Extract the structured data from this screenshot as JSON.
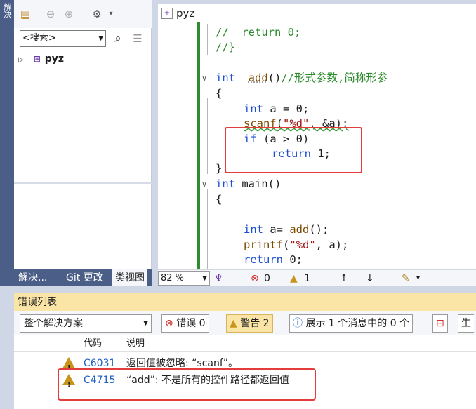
{
  "left_strip": {
    "label": "解决"
  },
  "solution_explorer": {
    "search_placeholder": "<搜索>",
    "project_name": "pyz",
    "tabs": [
      "解决...",
      "Git 更改",
      "类视图"
    ]
  },
  "editor": {
    "file_tab": "pyz",
    "lines": {
      "l0": "//  return 0;",
      "l1": "//}",
      "l2_kw": "int",
      "l2_fn": "add",
      "l2_rest": "()",
      "l2_cm": "//形式参数,简称形参",
      "l3": "{",
      "l4_kw": "int",
      "l4_rest": " a = 0;",
      "l5_fn": "scanf",
      "l5_a": "(",
      "l5_str": "\"%d\"",
      "l5_b": ", &a);",
      "l6_kw": "if",
      "l6_rest": " (a > 0)",
      "l7_kw": "return",
      "l7_rest": " 1;",
      "l8": "}",
      "l9_kw": "int",
      "l9_rest": " main()",
      "l10": "{",
      "l11_kw": "int",
      "l11_a": " a= ",
      "l11_fn": "add",
      "l11_b": "();",
      "l12_fn": "printf",
      "l12_a": "(",
      "l12_str": "\"%d\"",
      "l12_b": ", a);",
      "l13_kw": "return",
      "l13_rest": " 0;"
    },
    "status": {
      "zoom": "82 %",
      "errors": "0",
      "warnings": "1"
    }
  },
  "error_list": {
    "title": "错误列表",
    "scope": "整个解决方案",
    "errors_btn": "错误 0",
    "warnings_btn": "警告 2",
    "info_btn": "展示 1 个消息中的 0 个",
    "build_btn": "生",
    "headers": {
      "code": "代码",
      "desc": "说明"
    },
    "rows": [
      {
        "code": "C6031",
        "desc": "返回值被忽略: “scanf”。"
      },
      {
        "code": "C4715",
        "desc": "“add”: 不是所有的控件路径都返回值"
      }
    ]
  },
  "colors": {
    "keyword": "#1f4fd1",
    "comment": "#2a8a2a",
    "string": "#a31515",
    "highlight": "#e23c3c"
  }
}
